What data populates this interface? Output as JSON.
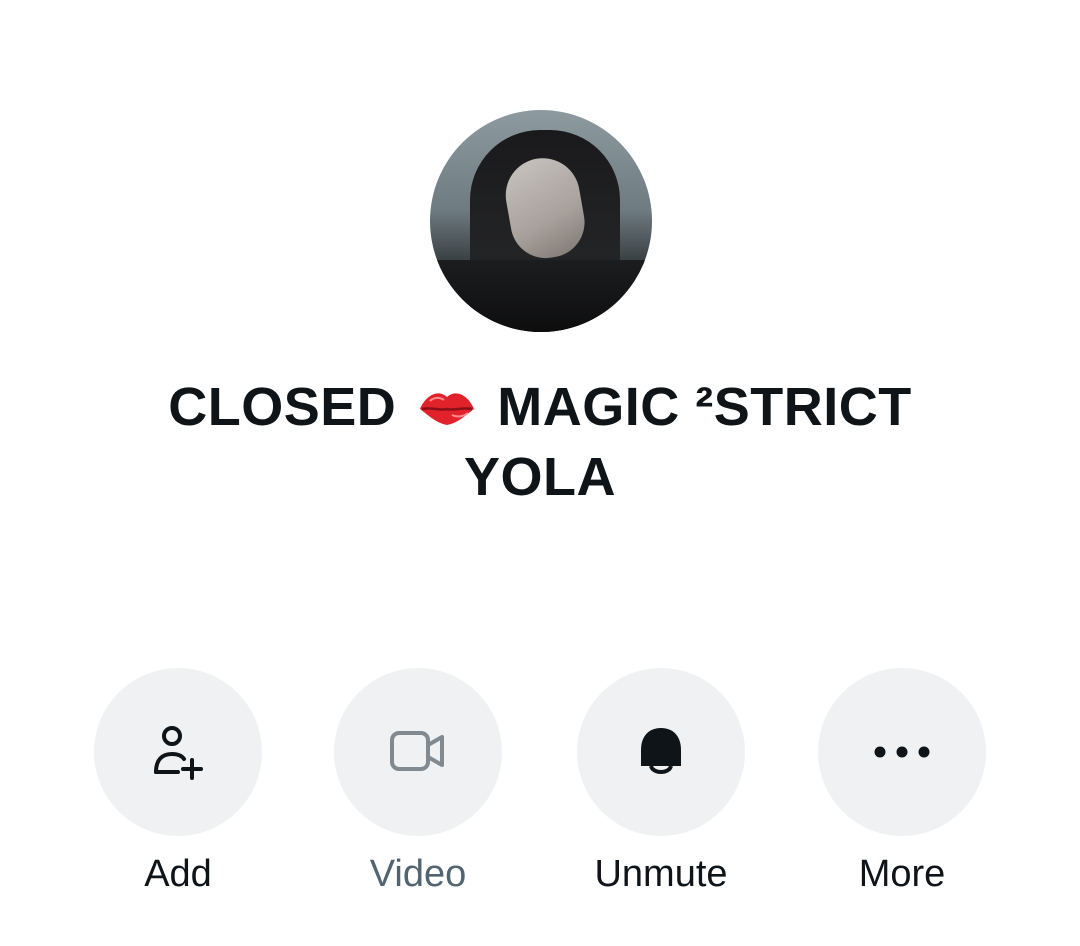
{
  "profile": {
    "name_part1": "CLOSED",
    "name_emoji": "kiss-mark-icon",
    "name_part2": "MAGIC",
    "name_superscript": "²",
    "name_part3": "STRICT",
    "name_line2": "YOLA"
  },
  "actions": [
    {
      "label": "Add",
      "icon": "add-person-icon",
      "enabled": true
    },
    {
      "label": "Video",
      "icon": "video-camera-icon",
      "enabled": false
    },
    {
      "label": "Unmute",
      "icon": "bell-icon",
      "enabled": true
    },
    {
      "label": "More",
      "icon": "more-dots-icon",
      "enabled": true
    }
  ],
  "colors": {
    "text_primary": "#0f1419",
    "text_secondary": "#536471",
    "button_bg": "#eff1f2",
    "emoji_red": "#e1222b"
  }
}
